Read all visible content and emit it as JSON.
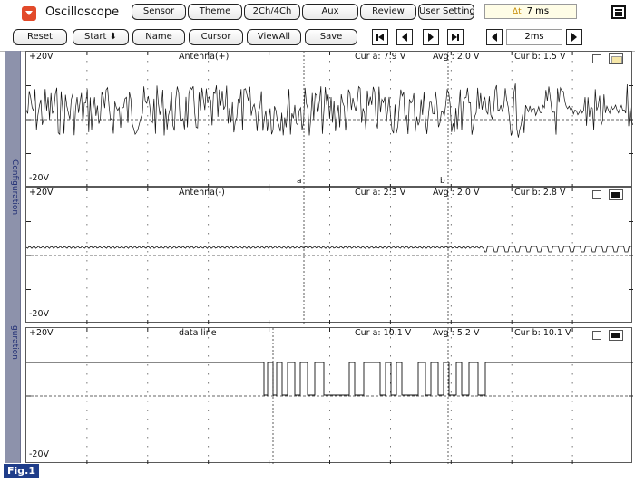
{
  "app": {
    "title": "Oscilloscope",
    "time_readout": "7 ms",
    "time_icon": "Δt"
  },
  "menu": [
    "Sensor",
    "Theme",
    "2Ch/4Ch",
    "Aux",
    "Review",
    "User Setting"
  ],
  "toolbar": {
    "reset": "Reset",
    "start": "Start ⬍",
    "name": "Name",
    "cursor": "Cursor",
    "viewall": "ViewAll",
    "save": "Save",
    "timebase": "2ms"
  },
  "sidebar": {
    "tab1": "Configuration",
    "tab2": "guration"
  },
  "channels": [
    {
      "name": "Antenna(+)",
      "top": "+20V",
      "bottom": "-20V",
      "cur_a": "Cur a: 7.9 V",
      "avg": "Avg : 2.0 V",
      "cur_b": "Cur b: 1.5 V",
      "cursor_a": "a",
      "cursor_b": "b",
      "color_box": "#f6e7a8"
    },
    {
      "name": "Antenna(-)",
      "top": "+20V",
      "bottom": "-20V",
      "cur_a": "Cur a: 2.3 V",
      "avg": "Avg : 2.0 V",
      "cur_b": "Cur b: 2.8 V",
      "color_box": "#111111"
    },
    {
      "name": "data line",
      "top": "+20V",
      "bottom": "-20V",
      "cur_a": "Cur a: 10.1 V",
      "avg": "Avg : 5.2 V",
      "cur_b": "Cur b: 10.1 V",
      "color_box": "#111111"
    }
  ],
  "footer": {
    "figure": "Fig.1"
  },
  "colors": {
    "accent": "#1f3d8a",
    "sidetab": "#8d92ab",
    "icon": "#e24a2a"
  }
}
